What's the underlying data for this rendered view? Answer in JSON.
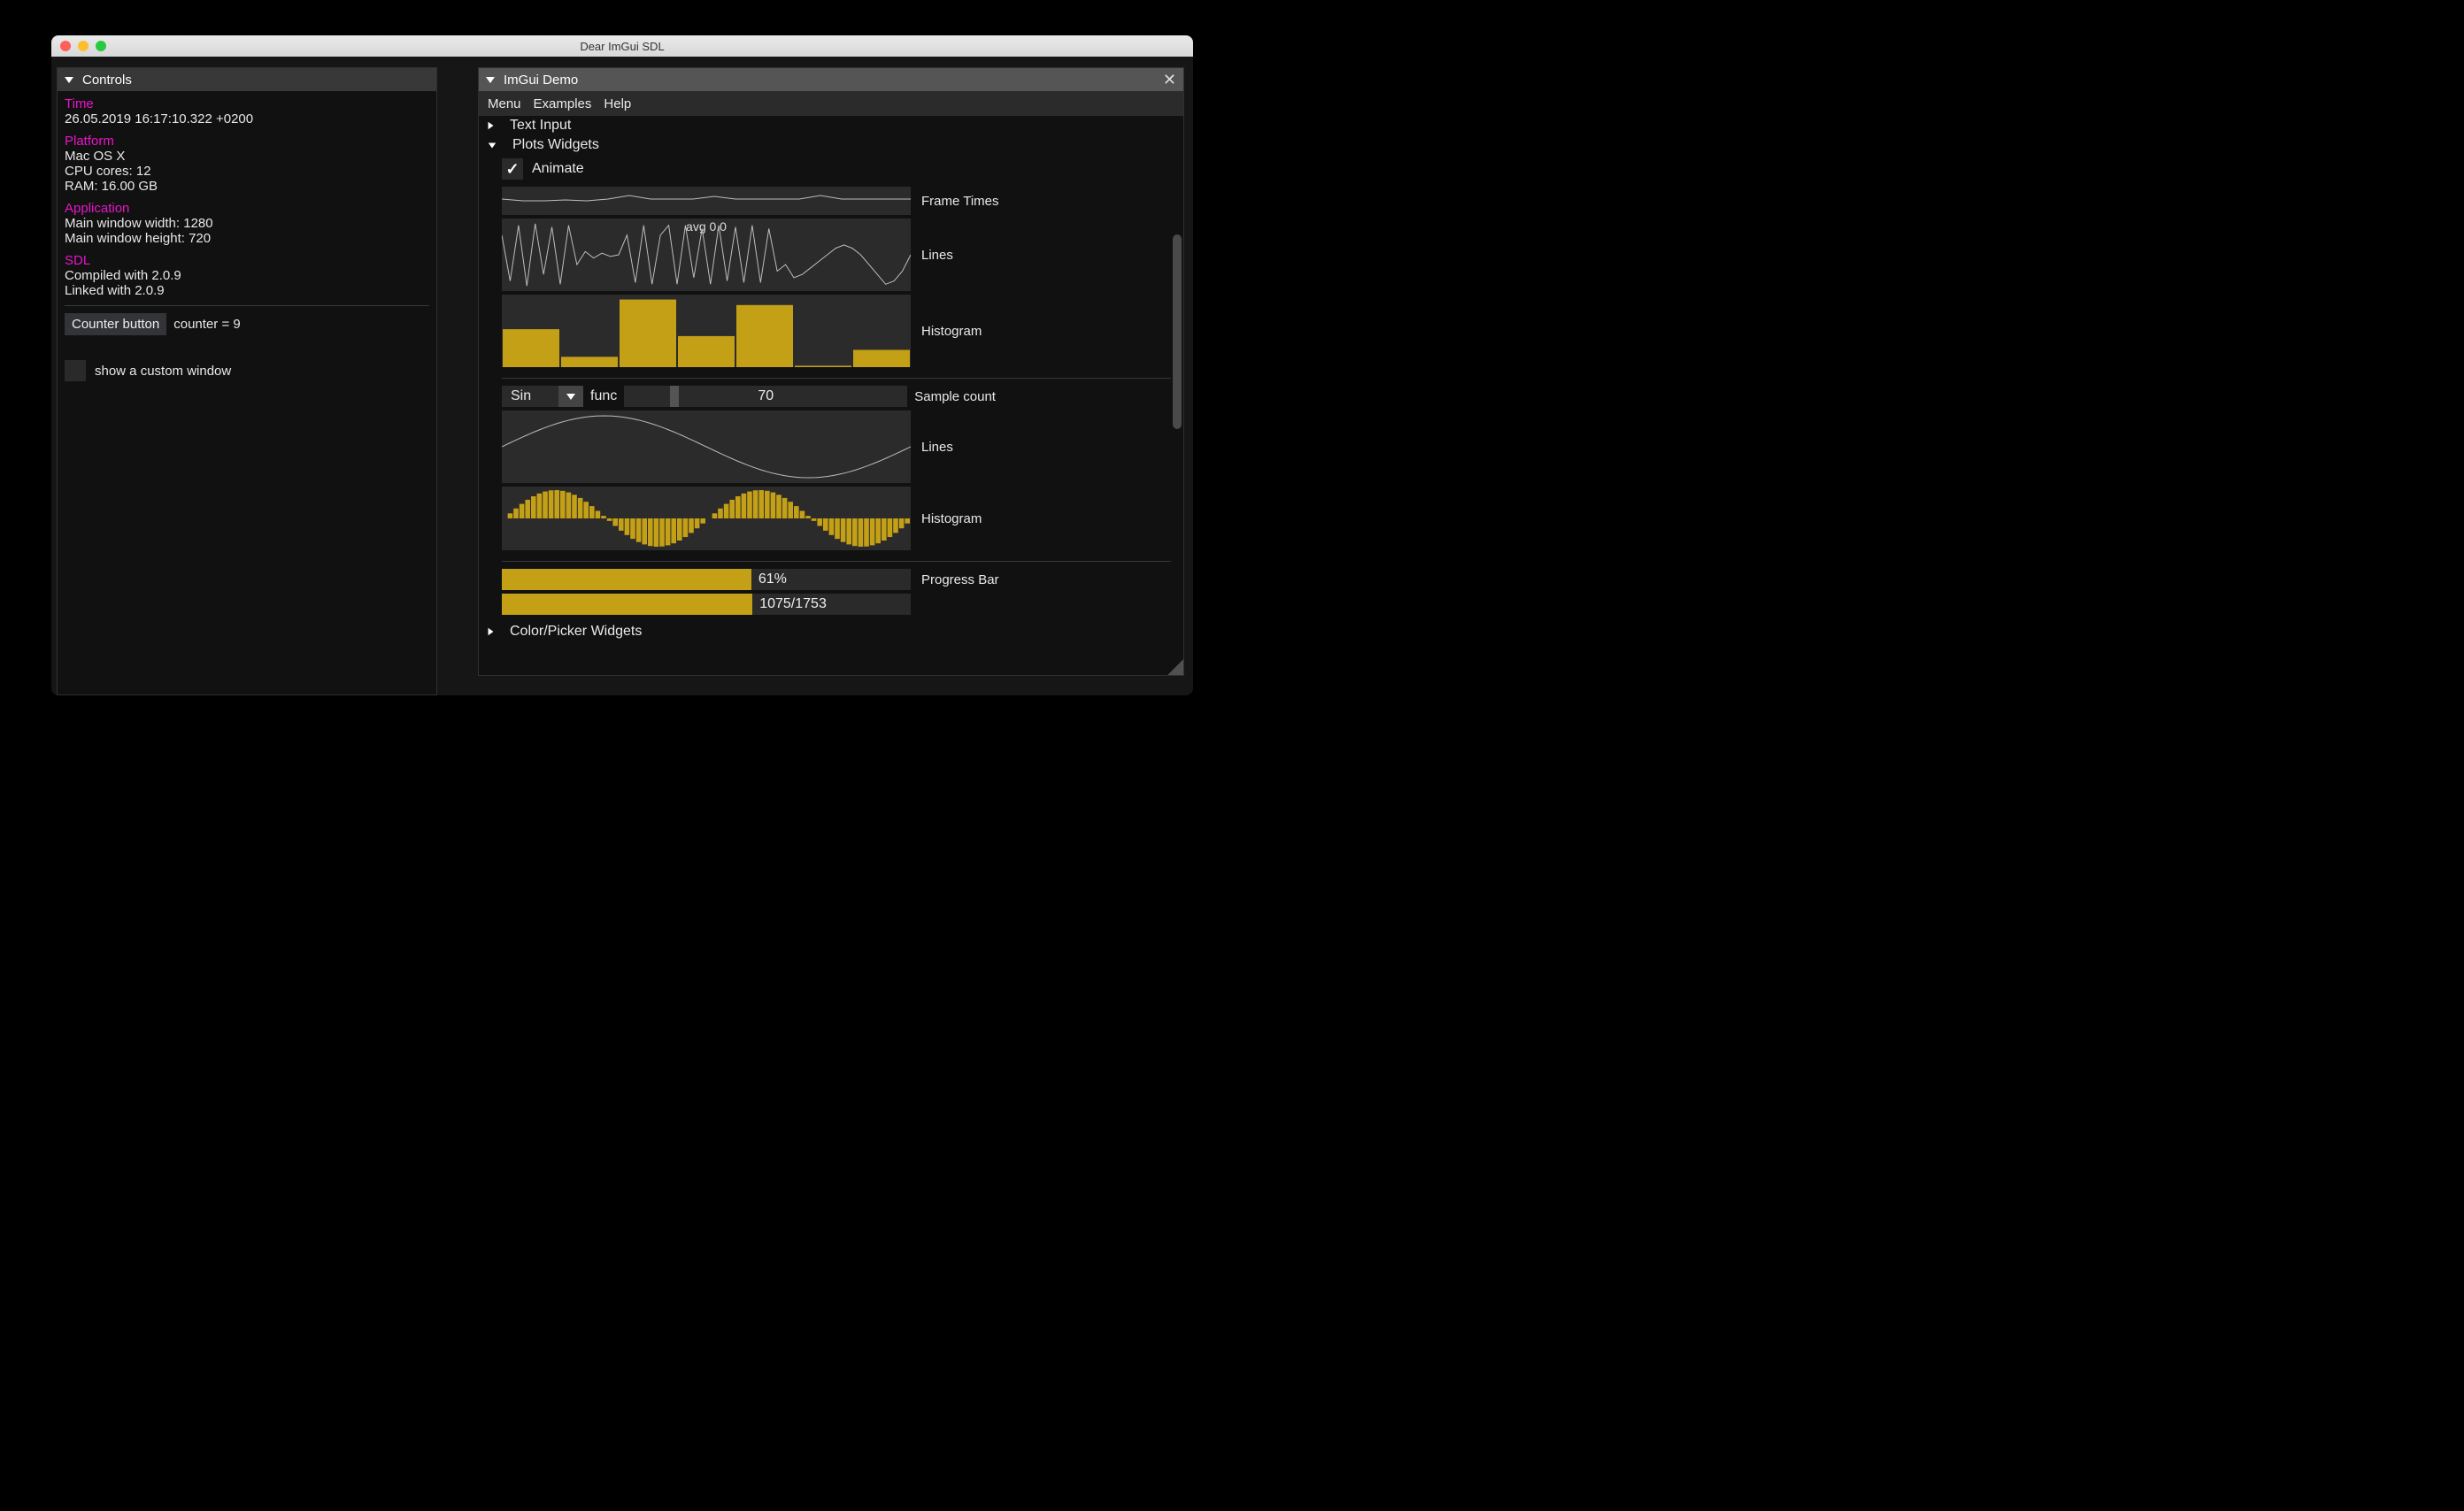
{
  "os_window": {
    "title": "Dear ImGui SDL"
  },
  "controls_window": {
    "title": "Controls",
    "time_label": "Time",
    "time_value": "26.05.2019 16:17:10.322 +0200",
    "platform_label": "Platform",
    "platform_os": "Mac OS X",
    "cpu": "CPU cores: 12",
    "ram": "RAM: 16.00 GB",
    "application_label": "Application",
    "win_w": "Main window width: 1280",
    "win_h": "Main window height: 720",
    "sdl_label": "SDL",
    "sdl_compiled": "Compiled with 2.0.9",
    "sdl_linked": "Linked with 2.0.9",
    "counter_button": "Counter button",
    "counter_value": "counter = 9",
    "custom_window_label": "show a custom window"
  },
  "demo_window": {
    "title": "ImGui Demo",
    "menu": {
      "menu": "Menu",
      "examples": "Examples",
      "help": "Help"
    },
    "text_input": "Text Input",
    "plots_widgets": "Plots Widgets",
    "animate": "Animate",
    "frame_times": "Frame Times",
    "lines_label": "Lines",
    "lines_avg": "avg 0.0",
    "histogram_label": "Histogram",
    "func_combo": {
      "value": "Sin",
      "label": "func"
    },
    "sample_count": {
      "value": "70",
      "label": "Sample count"
    },
    "progress_pct": "61%",
    "progress_label": "Progress Bar",
    "progress_ratio": "1075/1753",
    "color_picker": "Color/Picker Widgets"
  },
  "chart_data": [
    {
      "name": "frame_times",
      "type": "line",
      "title": "Frame Times",
      "x": [
        0,
        1,
        2,
        3,
        4,
        5,
        6,
        7,
        8,
        9,
        10,
        11,
        12,
        13,
        14,
        15,
        16,
        17,
        18,
        19
      ],
      "values": [
        0.5,
        0.45,
        0.45,
        0.46,
        0.45,
        0.5,
        0.6,
        0.5,
        0.5,
        0.5,
        0.58,
        0.5,
        0.5,
        0.5,
        0.5,
        0.61,
        0.5,
        0.5,
        0.5,
        0.5
      ]
    },
    {
      "name": "lines",
      "type": "line",
      "title": "Lines",
      "overlay": "avg 0.0",
      "ylim": [
        -1,
        1
      ],
      "x": [
        0,
        1,
        2,
        3,
        4,
        5,
        6,
        7,
        8,
        9,
        10,
        11,
        12,
        13,
        14,
        15,
        16,
        17,
        18,
        19,
        20,
        21,
        22,
        23,
        24,
        25,
        26,
        27,
        28,
        29,
        30,
        31,
        32,
        33,
        34,
        35,
        36,
        37,
        38,
        39,
        40,
        41,
        42,
        43,
        44,
        45,
        46,
        47,
        48,
        49
      ],
      "values": [
        0.6,
        -0.8,
        0.9,
        -0.95,
        0.95,
        -0.6,
        0.85,
        -0.9,
        0.9,
        -0.3,
        0.1,
        -0.1,
        0.05,
        -0.05,
        0.0,
        0.6,
        -0.85,
        0.9,
        -0.9,
        0.6,
        0.9,
        -0.9,
        0.9,
        -0.7,
        0.8,
        -0.9,
        0.9,
        -0.8,
        0.85,
        -0.85,
        0.9,
        -0.85,
        0.8,
        -0.5,
        -0.3,
        -0.7,
        -0.6,
        -0.4,
        -0.2,
        0.0,
        0.2,
        0.3,
        0.2,
        0.0,
        -0.3,
        -0.6,
        -0.9,
        -0.8,
        -0.5,
        0.0
      ]
    },
    {
      "name": "histogram",
      "type": "bar",
      "title": "Histogram",
      "ylim": [
        0,
        1
      ],
      "categories": [
        "0",
        "1",
        "2",
        "3",
        "4",
        "5",
        "6"
      ],
      "values": [
        0.55,
        0.15,
        0.98,
        0.45,
        0.9,
        0.02,
        0.25
      ]
    },
    {
      "name": "sin_lines",
      "type": "line",
      "title": "Lines",
      "ylim": [
        -1,
        1
      ],
      "x_range": [
        0,
        6.28
      ],
      "formula": "sin(x)"
    },
    {
      "name": "sin_histogram",
      "type": "bar",
      "title": "Histogram",
      "ylim": [
        -1,
        1
      ],
      "sample_count": 70,
      "formula": "sin(x)"
    },
    {
      "name": "progress",
      "type": "progress",
      "percent": 61,
      "value": 1075,
      "max": 1753
    }
  ]
}
